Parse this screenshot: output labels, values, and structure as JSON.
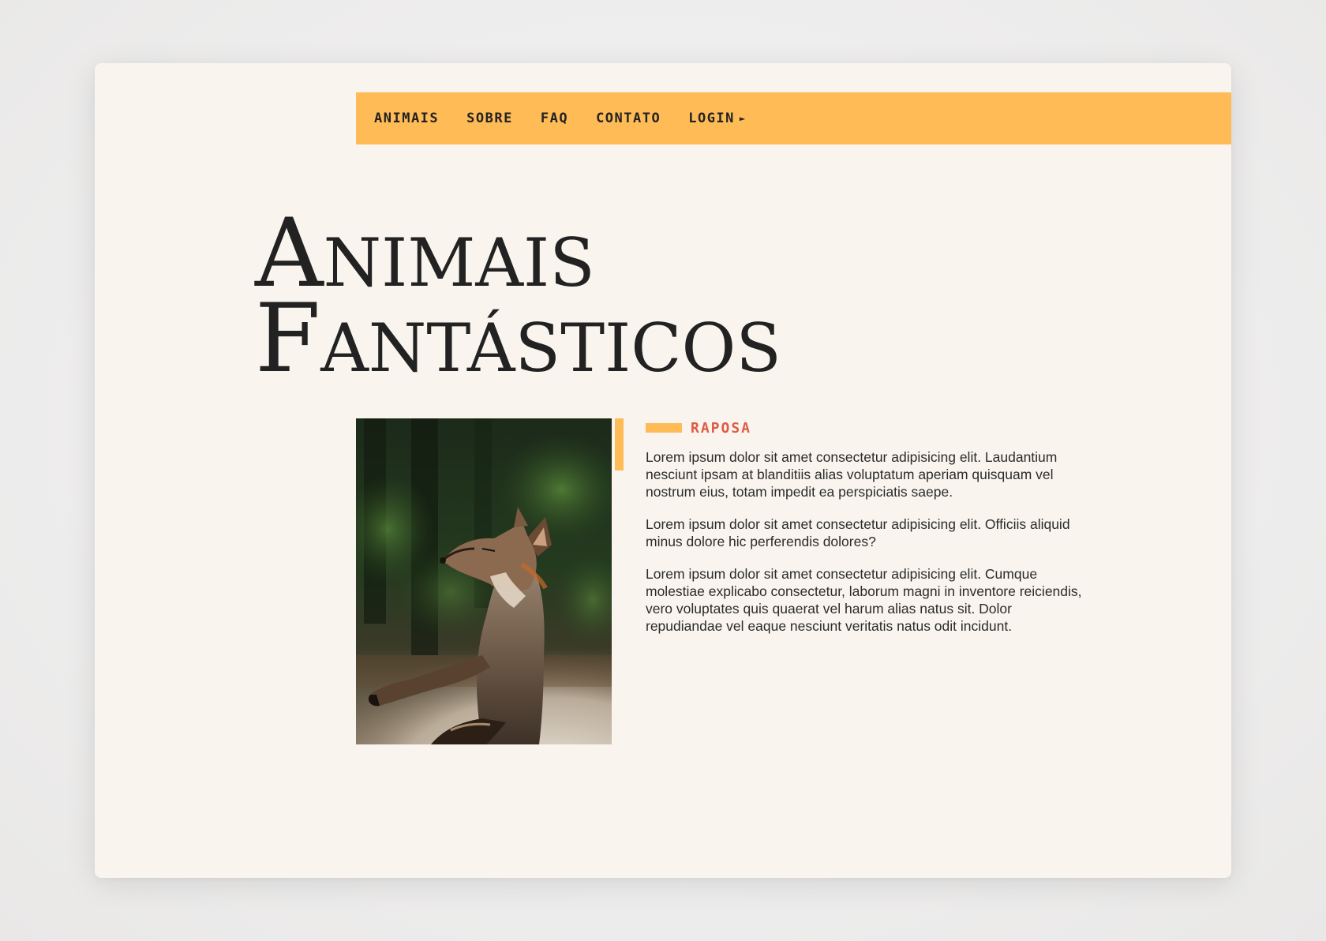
{
  "nav": {
    "items": [
      {
        "label": "ANIMAIS"
      },
      {
        "label": "SOBRE"
      },
      {
        "label": "FAQ"
      },
      {
        "label": "CONTATO"
      },
      {
        "label": "LOGIN"
      }
    ],
    "login_arrow": "►"
  },
  "hero": {
    "title_line1": "Animais",
    "title_line2": "Fantásticos"
  },
  "photo": {
    "alt": "fox-photo"
  },
  "article": {
    "tag": "RAPOSA",
    "paragraphs": [
      "Lorem ipsum dolor sit amet consectetur adipisicing elit. Laudantium nesciunt ipsam at blanditiis alias voluptatum aperiam quisquam vel nostrum eius, totam impedit ea perspiciatis saepe.",
      "Lorem ipsum dolor sit amet consectetur adipisicing elit. Officiis aliquid minus dolore hic perferendis dolores?",
      "Lorem ipsum dolor sit amet consectetur adipisicing elit. Cumque molestiae explicabo consectetur, laborum magni in inventore reiciendis, vero voluptates quis quaerat vel harum alias natus sit. Dolor repudiandae vel eaque nesciunt veritatis natus odit incidunt."
    ]
  },
  "colors": {
    "accent": "#ffbb55",
    "tag": "#e05a45",
    "card_bg": "#f9f5ee",
    "text": "#222222"
  }
}
